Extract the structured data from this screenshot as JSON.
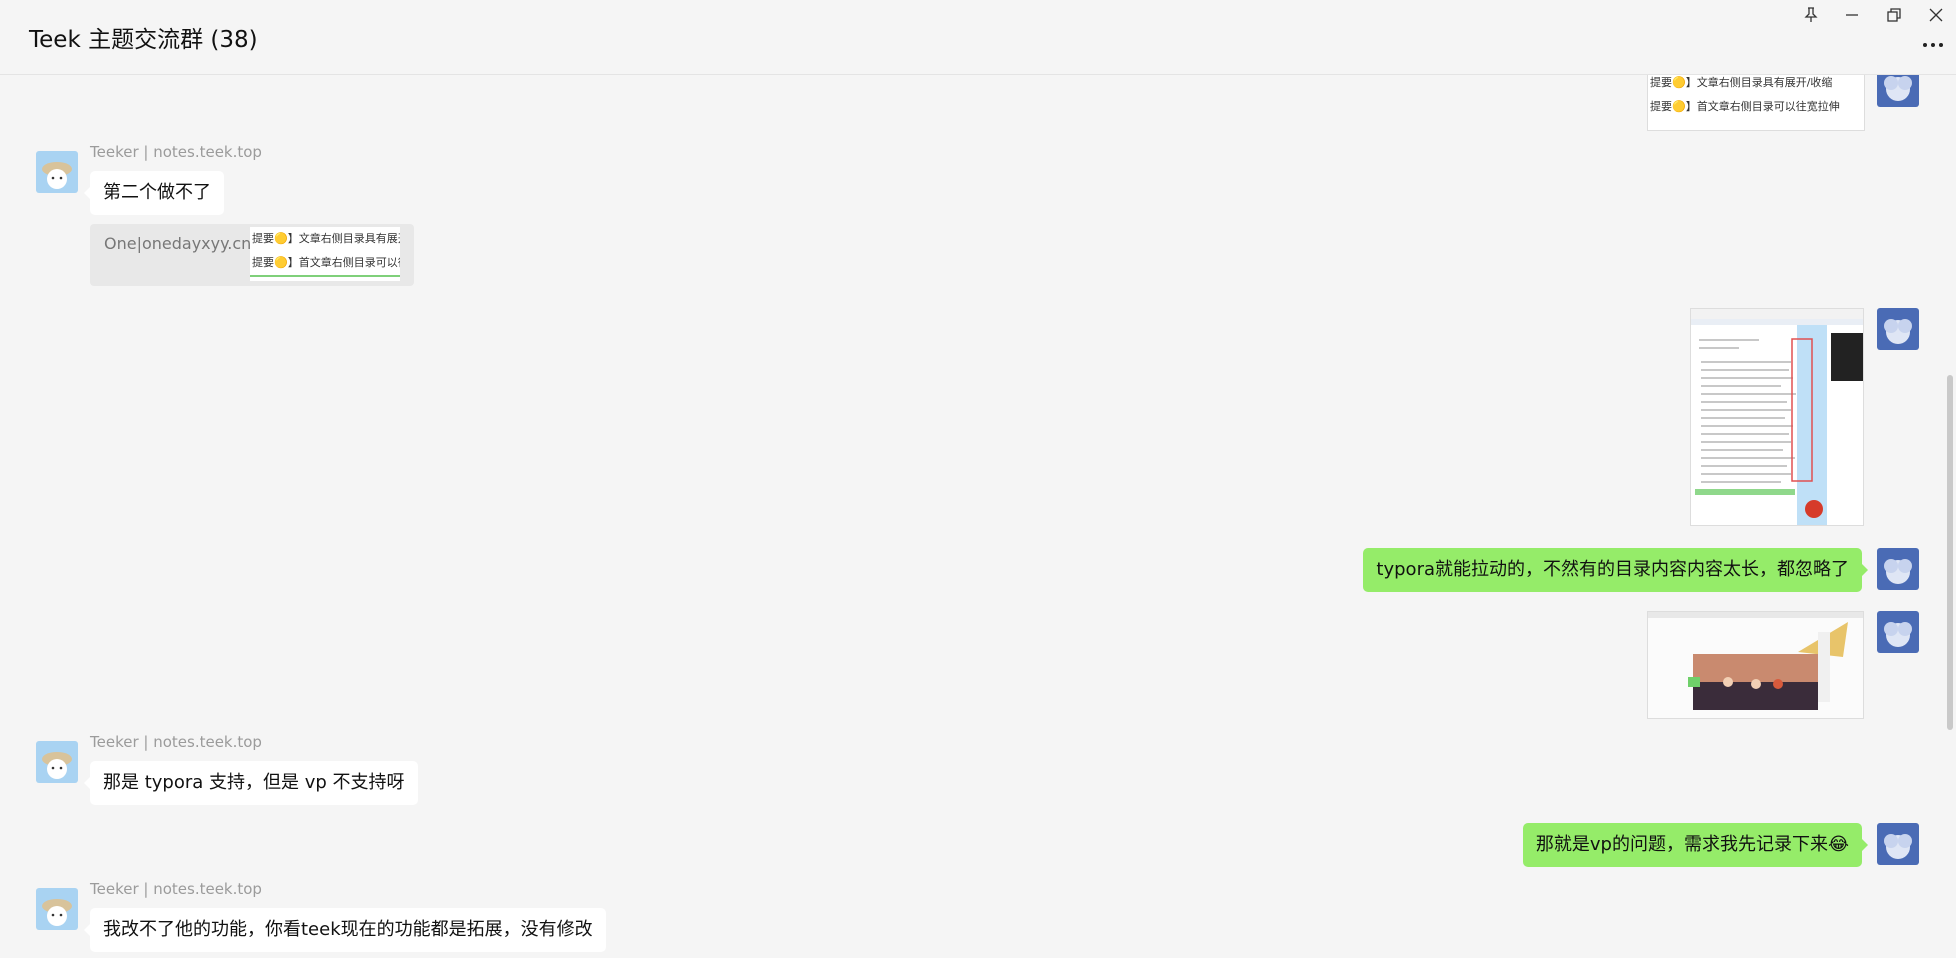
{
  "window": {
    "title": "Teek 主题交流群 (38)",
    "buttons": [
      "pin-icon",
      "minimize-icon",
      "restore-icon",
      "close-icon"
    ],
    "more_icon": "more-dots-icon"
  },
  "colors": {
    "self_bubble": "#95ec69",
    "other_bubble": "#ffffff",
    "background": "#f5f5f5"
  },
  "top_image": {
    "line1": "提要🟡】文章右侧目录具有展开/收缩",
    "line2": "提要🟡】首文章右侧目录可以往宽拉伸"
  },
  "messages": [
    {
      "sender": "Teeker | notes.teek.top",
      "text": "第二个做不了"
    },
    {
      "quote_label": "One|onedayxyy.cn：",
      "quote_line1": "提要🟡】文章右侧目录具有展开/收缩",
      "quote_line2": "提要🟡】首文章右侧目录可以往宽拉伸"
    },
    {
      "self_text": "typora就能拉动的，不然有的目录内容内容太长，都忽略了"
    },
    {
      "sender": "Teeker | notes.teek.top",
      "text": "那是 typora 支持，但是 vp 不支持呀"
    },
    {
      "self_text": "那就是vp的问题，需求我先记录下来😂"
    },
    {
      "sender": "Teeker | notes.teek.top",
      "text": "我改不了他的功能，你看teek现在的功能都是拓展，没有修改"
    }
  ]
}
